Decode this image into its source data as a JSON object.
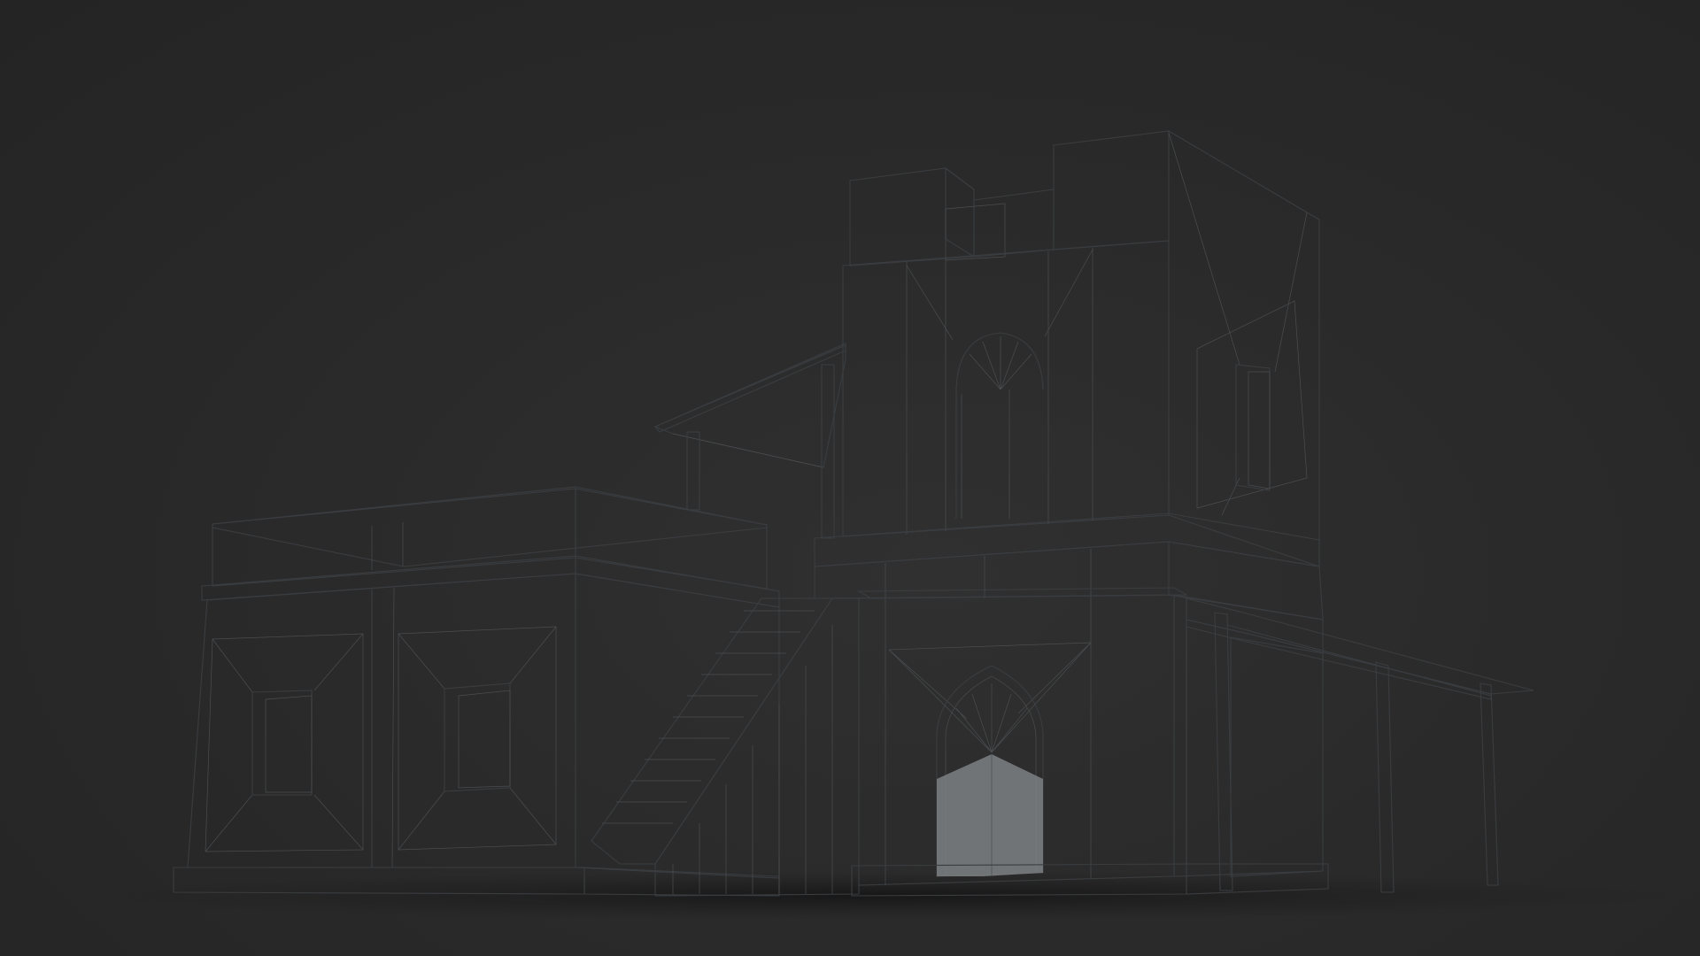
{
  "render": {
    "subject": "",
    "background_color": "#2a2a2a",
    "material_color": "#a7abae"
  }
}
